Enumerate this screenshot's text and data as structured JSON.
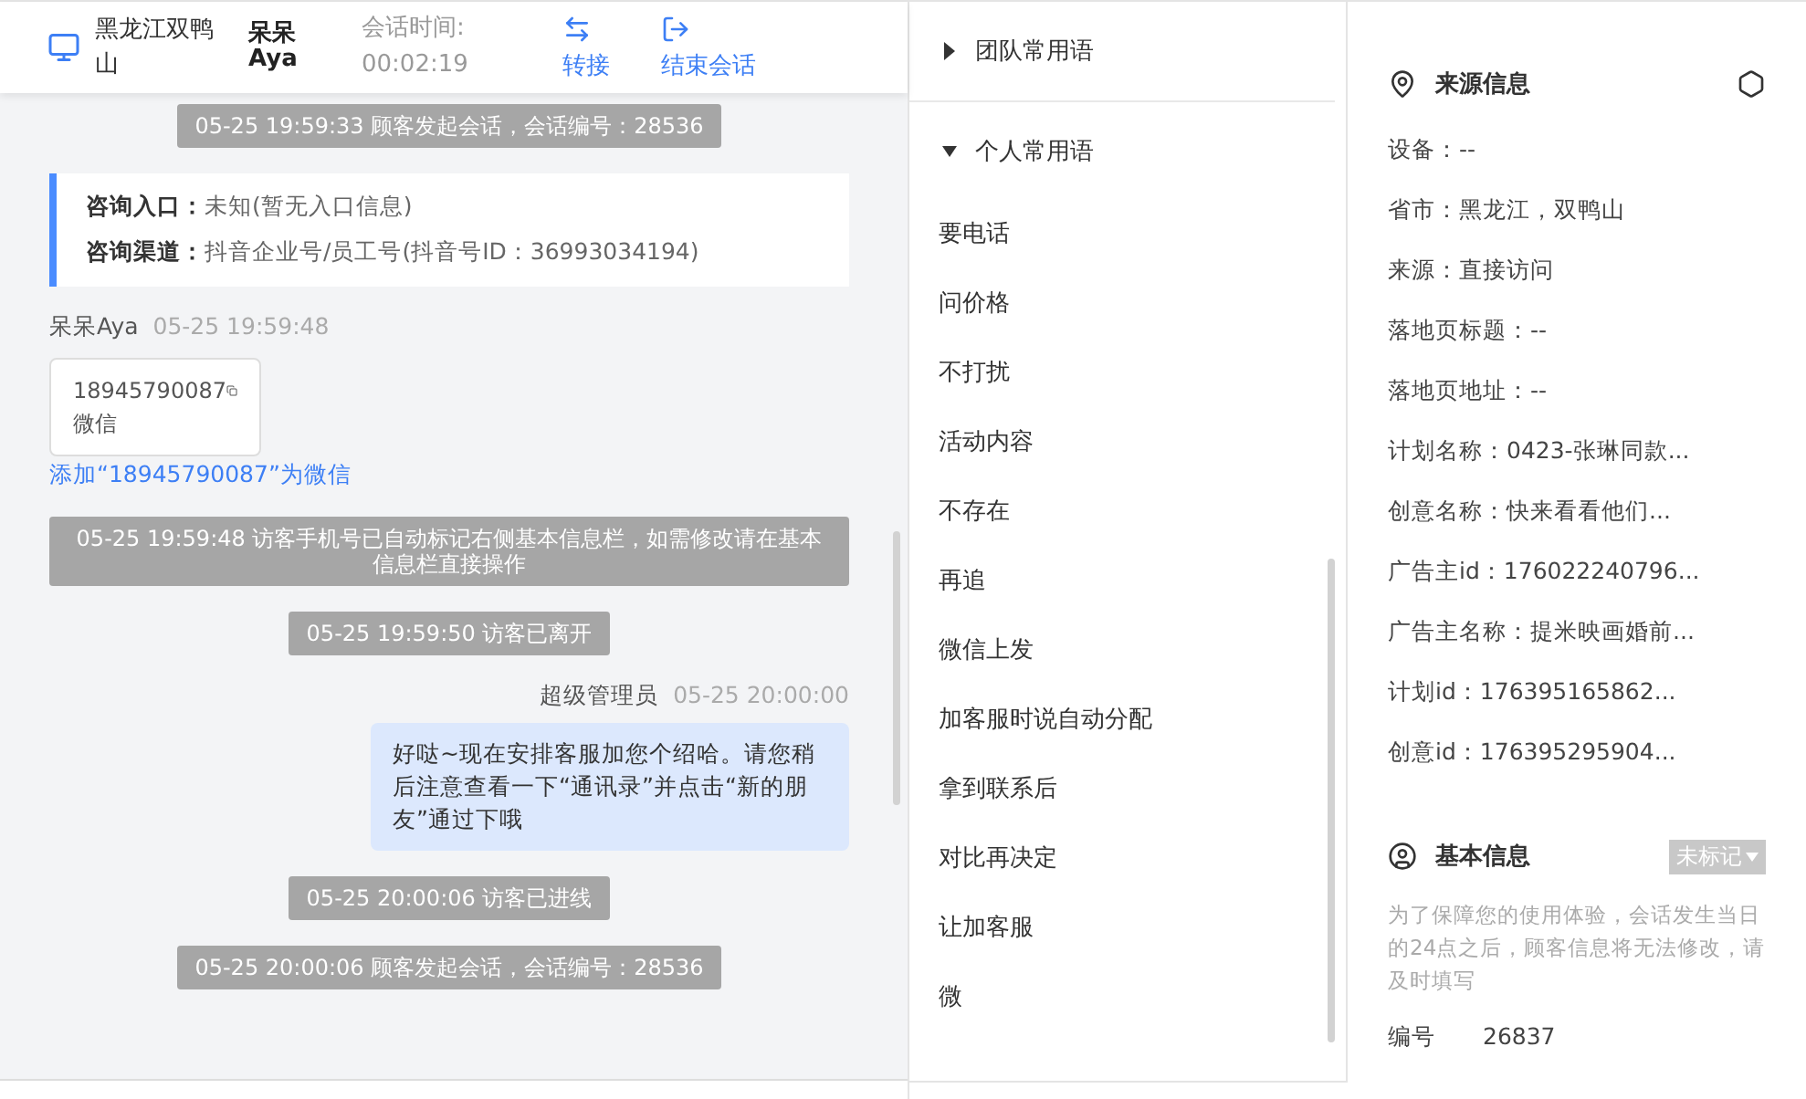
{
  "header": {
    "location": "黑龙江双鸭山",
    "visitor": "呆呆 Aya",
    "session_time_label": "会话时间:",
    "session_time": "00:02:19",
    "actions": [
      {
        "kind": "transfer",
        "label": "转接"
      },
      {
        "kind": "end",
        "label": "结束会话"
      }
    ]
  },
  "chat": [
    {
      "kind": "notice",
      "text": "05-25 19:59:33 顾客发起会话，会话编号：28536"
    },
    {
      "kind": "info_card",
      "rows": [
        {
          "label": "咨询入口：",
          "value": "未知(暂无入口信息)"
        },
        {
          "label": "咨询渠道：",
          "value": "抖音企业号/员工号(抖音号ID：36993034194)"
        }
      ]
    },
    {
      "kind": "visitor",
      "sender": "呆呆Aya",
      "time": "05-25 19:59:48",
      "card": {
        "number": "18945790087",
        "type": "微信"
      },
      "link": "添加“18945790087”为微信"
    },
    {
      "kind": "notice",
      "text": "05-25 19:59:48 访客手机号已自动标记右侧基本信息栏，如需修改请在基本信息栏直接操作"
    },
    {
      "kind": "notice",
      "text": "05-25 19:59:50 访客已离开"
    },
    {
      "kind": "agent",
      "sender": "超级管理员",
      "time": "05-25 20:00:00",
      "text": "好哒~现在安排客服加您个绍哈。请您稍后注意查看一下“通讯录”并点击“新的朋友”通过下哦"
    },
    {
      "kind": "notice",
      "text": "05-25 20:00:06 访客已进线"
    },
    {
      "kind": "notice",
      "text": "05-25 20:00:06 顾客发起会话，会话编号：28536"
    }
  ],
  "phrases": [
    {
      "title": "团队常用语",
      "expanded": false
    },
    {
      "title": "个人常用语",
      "expanded": true,
      "items": [
        "要电话",
        "问价格",
        "不打扰",
        "活动内容",
        "不存在",
        "再追",
        "微信上发",
        "加客服时说自动分配",
        "拿到联系后",
        "对比再决定",
        "让加客服",
        "微"
      ]
    }
  ],
  "source": {
    "title": "来源信息",
    "fields": [
      "设备：--",
      "省市：黑龙江，双鸭山",
      "来源：直接访问",
      "落地页标题：--",
      "落地页地址：--",
      "计划名称：0423-张琳同款...",
      "创意名称：快来看看他们...",
      "广告主id：176022240796...",
      "广告主名称：提米映画婚前...",
      "计划id：176395165862...",
      "创意id：176395295904..."
    ]
  },
  "basic": {
    "title": "基本信息",
    "tag": "未标记",
    "note": "为了保障您的使用体验，会话发生当日的24点之后，顾客信息将无法修改，请及时填写",
    "id_label": "编号",
    "id_value": "26837"
  }
}
